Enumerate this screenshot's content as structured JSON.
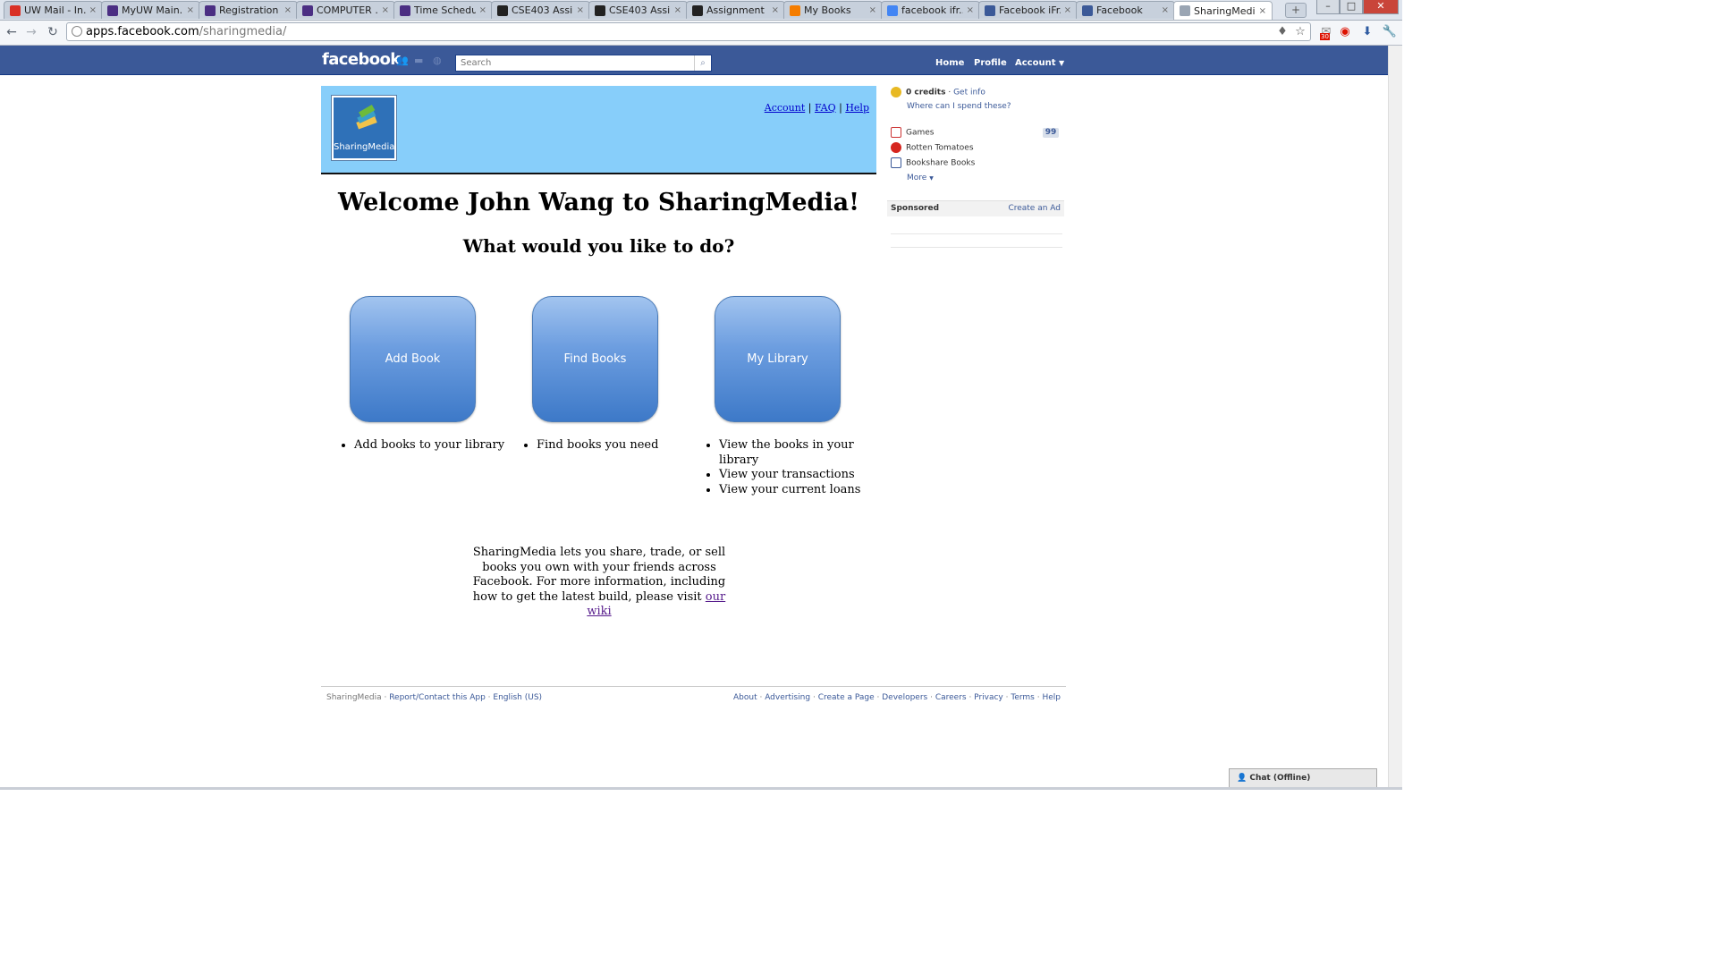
{
  "browser": {
    "tabs": [
      {
        "title": "UW Mail - In...",
        "icon": "gmail-icon",
        "color": "#d93025"
      },
      {
        "title": "MyUW Main...",
        "icon": "myuw-icon",
        "color": "#4b2e83"
      },
      {
        "title": "Registration",
        "icon": "uw-w-icon",
        "color": "#4b2e83"
      },
      {
        "title": "COMPUTER ...",
        "icon": "uw-w-icon",
        "color": "#4b2e83"
      },
      {
        "title": "Time Schedu...",
        "icon": "uw-w-icon",
        "color": "#4b2e83"
      },
      {
        "title": "CSE403 Assi...",
        "icon": "cse-icon",
        "color": "#222222"
      },
      {
        "title": "CSE403 Assi...",
        "icon": "cse-icon",
        "color": "#222222"
      },
      {
        "title": "Assignment ...",
        "icon": "cse-icon",
        "color": "#222222"
      },
      {
        "title": "My Books",
        "icon": "blogger-icon",
        "color": "#f57d00"
      },
      {
        "title": "facebook ifr...",
        "icon": "google-icon",
        "color": "#4285f4"
      },
      {
        "title": "Facebook iFr...",
        "icon": "facebook-icon",
        "color": "#3b5998"
      },
      {
        "title": "Facebook",
        "icon": "facebook-icon",
        "color": "#3b5998"
      },
      {
        "title": "SharingMedi...",
        "icon": "loading-icon",
        "color": "#9aa5b3"
      }
    ],
    "url_host": "apps.facebook.com",
    "url_path": "/sharingmedia/",
    "extension_badge": "30"
  },
  "facebook": {
    "logo": "facebook",
    "search_placeholder": "Search",
    "nav": {
      "home": "Home",
      "profile": "Profile",
      "account": "Account"
    }
  },
  "app": {
    "logo_label": "SharingMedia",
    "links": {
      "account": "Account",
      "faq": "FAQ",
      "help": "Help",
      "sep": "|"
    },
    "welcome": "Welcome John Wang to SharingMedia!",
    "question": "What would you like to do?",
    "actions": [
      {
        "label": "Add Book",
        "bullets": [
          "Add books to your library"
        ]
      },
      {
        "label": "Find Books",
        "bullets": [
          "Find books you need"
        ]
      },
      {
        "label": "My Library",
        "bullets": [
          "View the books in your library",
          "View your transactions",
          "View your current loans"
        ]
      }
    ],
    "about_text": "SharingMedia lets you share, trade, or sell books you own with your friends across Facebook. For more information, including how to get the latest build, please visit",
    "about_link": "our wiki"
  },
  "sidebar": {
    "credits": "0 credits",
    "get_info": "Get info",
    "spend": "Where can I spend these?",
    "bookmarks": [
      {
        "label": "Games",
        "badge": "99",
        "icon": "games-icon"
      },
      {
        "label": "Rotten Tomatoes",
        "icon": "tomato-icon"
      },
      {
        "label": "Bookshare Books",
        "icon": "book-icon"
      }
    ],
    "more": "More",
    "sponsored": "Sponsored",
    "create_ad": "Create an Ad"
  },
  "footer": {
    "app_name": "SharingMedia",
    "report": "Report/Contact this App",
    "language": "English (US)",
    "links": [
      "About",
      "Advertising",
      "Create a Page",
      "Developers",
      "Careers",
      "Privacy",
      "Terms",
      "Help"
    ]
  },
  "chat": {
    "label": "Chat (Offline)"
  }
}
